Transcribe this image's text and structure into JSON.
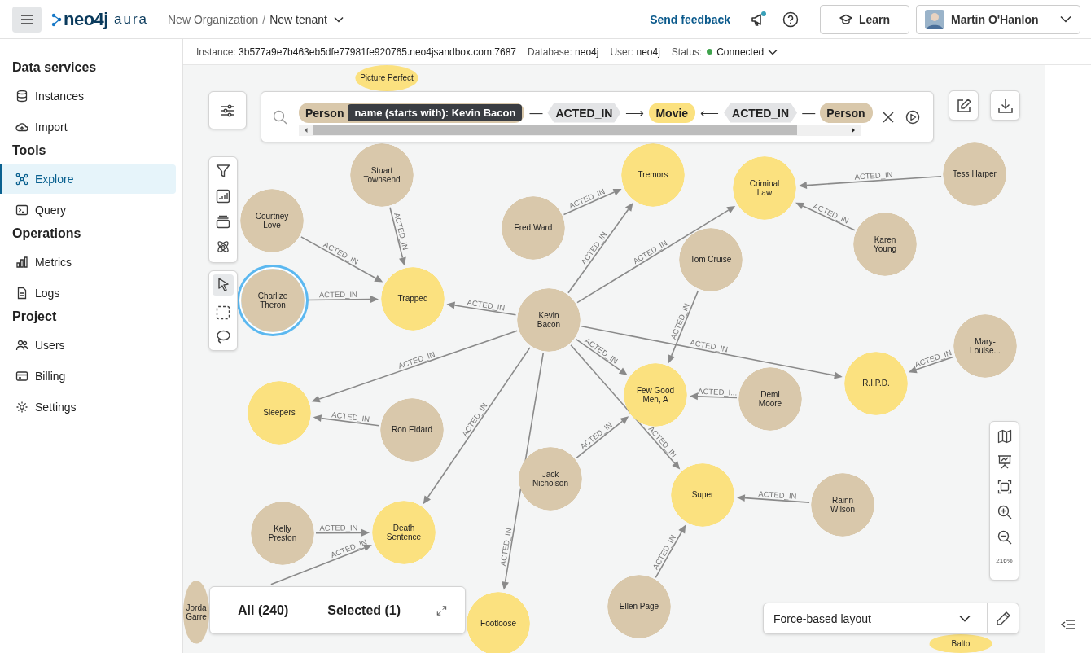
{
  "header": {
    "logo": "neo4j",
    "logo_suffix": "aura",
    "organization": "New Organization",
    "separator": "/",
    "tenant": "New tenant",
    "feedback": "Send feedback",
    "learn": "Learn",
    "user": "Martin O'Hanlon",
    "notification": true
  },
  "info_bar": [
    {
      "label": "Instance:",
      "value": "3b577a9e7b463eb5dfe77981fe920765.neo4jsandbox.com:7687"
    },
    {
      "label": "Database:",
      "value": "neo4j"
    },
    {
      "label": "User:",
      "value": "neo4j"
    }
  ],
  "status": {
    "label": "Status:",
    "value": "Connected",
    "connected": true
  },
  "sidebar": [
    {
      "title": "Data services",
      "items": [
        {
          "label": "Instances",
          "selected": false
        },
        {
          "label": "Import",
          "selected": false
        }
      ]
    },
    {
      "title": "Tools",
      "items": [
        {
          "label": "Explore",
          "selected": true
        },
        {
          "label": "Query",
          "selected": false
        }
      ]
    },
    {
      "title": "Operations",
      "items": [
        {
          "label": "Metrics",
          "selected": false
        },
        {
          "label": "Logs",
          "selected": false
        }
      ]
    },
    {
      "title": "Project",
      "items": [
        {
          "label": "Users",
          "selected": false
        },
        {
          "label": "Billing",
          "selected": false
        },
        {
          "label": "Settings",
          "selected": false
        }
      ]
    }
  ],
  "search_pattern": [
    {
      "kind": "node",
      "label": "Person",
      "color": "#d9c8ab",
      "filter": "name (starts with): Kevin Bacon"
    },
    {
      "kind": "link",
      "text": "—"
    },
    {
      "kind": "rel",
      "label": "ACTED_IN"
    },
    {
      "kind": "link",
      "text": "⟶"
    },
    {
      "kind": "node",
      "label": "Movie",
      "color": "#fbe17f"
    },
    {
      "kind": "link",
      "text": "⟵"
    },
    {
      "kind": "rel",
      "label": "ACTED_IN"
    },
    {
      "kind": "link",
      "text": "—"
    },
    {
      "kind": "node",
      "label": "Person",
      "color": "#d9c8ab"
    }
  ],
  "nodes": [
    {
      "name": "Picture Perfect",
      "kind": "movie",
      "selected": false
    },
    {
      "name": "Stuart Townsend",
      "kind": "person",
      "selected": false
    },
    {
      "name": "Tremors",
      "kind": "movie",
      "selected": false
    },
    {
      "name": "Tess Harper",
      "kind": "person",
      "selected": false
    },
    {
      "name": "Criminal Law",
      "kind": "movie",
      "selected": false
    },
    {
      "name": "Courtney Love",
      "kind": "person",
      "selected": false
    },
    {
      "name": "Fred Ward",
      "kind": "person",
      "selected": false
    },
    {
      "name": "Karen Young",
      "kind": "person",
      "selected": false
    },
    {
      "name": "Tom Cruise",
      "kind": "person",
      "selected": false
    },
    {
      "name": "Charlize Theron",
      "kind": "person",
      "selected": true
    },
    {
      "name": "Trapped",
      "kind": "movie",
      "selected": false
    },
    {
      "name": "Kevin Bacon",
      "kind": "person",
      "selected": false
    },
    {
      "name": "Mary-Louise...",
      "kind": "person",
      "selected": false
    },
    {
      "name": "R.I.P.D.",
      "kind": "movie",
      "selected": false
    },
    {
      "name": "Few Good Men, A",
      "kind": "movie",
      "selected": false
    },
    {
      "name": "Demi Moore",
      "kind": "person",
      "selected": false
    },
    {
      "name": "Sleepers",
      "kind": "movie",
      "selected": false
    },
    {
      "name": "Ron Eldard",
      "kind": "person",
      "selected": false
    },
    {
      "name": "Jack Nicholson",
      "kind": "person",
      "selected": false
    },
    {
      "name": "Super",
      "kind": "movie",
      "selected": false
    },
    {
      "name": "Rainn Wilson",
      "kind": "person",
      "selected": false
    },
    {
      "name": "Kelly Preston",
      "kind": "person",
      "selected": false
    },
    {
      "name": "Death Sentence",
      "kind": "movie",
      "selected": false
    },
    {
      "name": "Ellen Page",
      "kind": "person",
      "selected": false
    },
    {
      "name": "Jorda Garre",
      "kind": "person",
      "selected": false
    },
    {
      "name": "Footloose",
      "kind": "movie",
      "selected": false
    },
    {
      "name": "Balto",
      "kind": "movie",
      "selected": false
    }
  ],
  "relationships": [
    {
      "label": "ACTED_IN"
    },
    {
      "label": "ACTED_IN"
    },
    {
      "label": "ACTED_IN"
    },
    {
      "label": "ACTED_IN"
    },
    {
      "label": "ACTED_IN"
    },
    {
      "label": "ACTED_IN"
    },
    {
      "label": "ACTED_IN"
    },
    {
      "label": "ACTED_IN"
    },
    {
      "label": "ACTED_IN"
    },
    {
      "label": "ACTED_IN"
    },
    {
      "label": "ACTED_IN"
    },
    {
      "label": "ACTED_IN"
    },
    {
      "label": "ACTED_IN"
    },
    {
      "label": "ACTED_IN"
    },
    {
      "label": "ACTED_IN"
    },
    {
      "label": "ACTED_IN"
    },
    {
      "label": "ACTED_I..."
    },
    {
      "label": "ACTED_IN"
    },
    {
      "label": "ACTED_IN"
    },
    {
      "label": "ACTED_IN"
    },
    {
      "label": "ACTED_IN"
    },
    {
      "label": "ACTED_IN"
    },
    {
      "label": "ACTED_IN"
    },
    {
      "label": "ACTED_IN"
    }
  ],
  "results": {
    "all": "All (240)",
    "selected": "Selected (1)"
  },
  "layout": {
    "value": "Force-based layout"
  },
  "zoom": "216%"
}
